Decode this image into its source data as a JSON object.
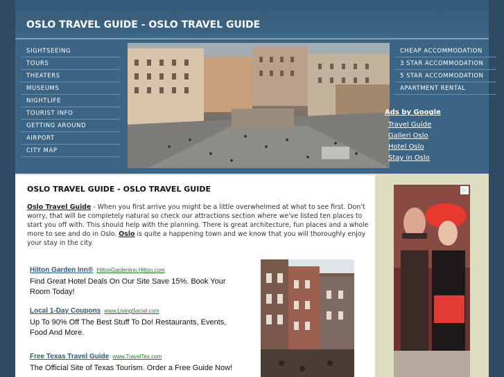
{
  "header": {
    "title": "OSLO TRAVEL GUIDE - OSLO TRAVEL GUIDE"
  },
  "left_nav": {
    "items": [
      "SIGHTSEEING",
      "TOURS",
      "THEATERS",
      "MUSEUMS",
      "NIGHTLIFE",
      "TOURIST INFO",
      "GETTING AROUND",
      "AIRPORT",
      "CITY MAP"
    ]
  },
  "right_nav": {
    "items": [
      "CHEAP ACCOMMODATION",
      "3 STAR ACCOMMODATION",
      "5 STAR ACCOMMODATION",
      "APARTMENT RENTAL"
    ],
    "ads_title": "Ads by Google",
    "ads": [
      "Travel Guide",
      "Galleri Oslo",
      "Hotel Oslo",
      "Stay in Oslo"
    ]
  },
  "content": {
    "title": "OSLO TRAVEL GUIDE - OSLO TRAVEL GUIDE",
    "intro_link": "Oslo Travel Guide",
    "intro_text_1": " - When you first arrive you might be a little overwhelmed at what to see first. Don't worry, that will be completely natural so check our attractions section where we've listed ten places to start you off with. This should help with the planning. There is great architecture, fun places and a whole more to see and do in Oslo. ",
    "intro_link_2": "Oslo",
    "intro_text_2": " is quite a happening town and we know that you will thoroughly enjoy your stay in the city."
  },
  "sponsored": [
    {
      "title": "Hilton Garden Inn®",
      "url": "HiltonGardenInn.Hilton.com",
      "desc": "Find Great Hotel Deals On Our Site Save 15%. Book Your Room Today!"
    },
    {
      "title": "Local 1-Day Coupons",
      "url": "www.LivingSocial.com",
      "desc": "Up To 90% Off The Best Stuff To Do! Restaurants, Events, Food And More."
    },
    {
      "title": "Free Texas Travel Guide",
      "url": "www.TravelTex.com",
      "desc": "The Official Site of Texas Tourism. Order a Free Guide Now!"
    }
  ],
  "colors": {
    "page_bg": "#2f4b63",
    "panel": "#3c6585",
    "link": "#30597c",
    "url": "#2f6a33",
    "side_bg": "#dcdcc0"
  },
  "icons": {
    "adchoices": "adchoices-icon"
  }
}
